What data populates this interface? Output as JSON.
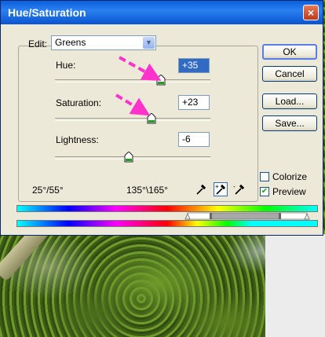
{
  "dialog": {
    "title": "Hue/Saturation",
    "close_glyph": "×"
  },
  "edit": {
    "label": "Edit:",
    "value": "Greens"
  },
  "hue": {
    "label": "Hue:",
    "value": "+35"
  },
  "saturation": {
    "label": "Saturation:",
    "value": "+23"
  },
  "lightness": {
    "label": "Lightness:",
    "value": "-6"
  },
  "buttons": {
    "ok": "OK",
    "cancel": "Cancel",
    "load": "Load...",
    "save": "Save..."
  },
  "options": {
    "colorize_label": "Colorize",
    "colorize_checked": false,
    "preview_label": "Preview",
    "preview_checked": true
  },
  "ranges": {
    "left": "25°/55°",
    "right": "135°\\165°"
  },
  "icons": [
    "chevron-down-icon",
    "eyedropper-icon",
    "eyedropper-plus-icon",
    "eyedropper-minus-icon",
    "close-icon",
    "annotation-arrow-icon"
  ],
  "colors": {
    "title_bar": "#0a5fdd",
    "dialog_bg": "#ece9d8",
    "annotation_arrow": "#ff33cc",
    "thumb_fill": "#21a121"
  }
}
